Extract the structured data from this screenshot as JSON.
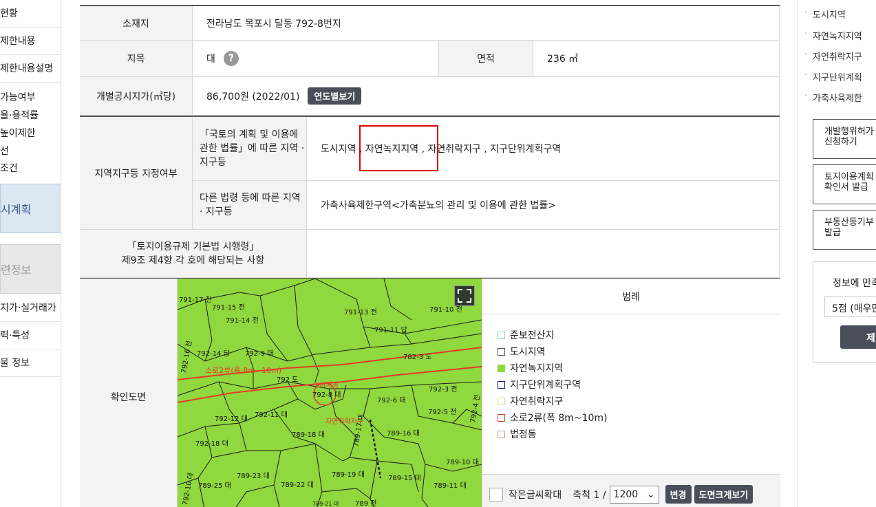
{
  "left_menu": {
    "items": [
      "현황",
      "제한내용",
      "제한내용설명",
      "가능여부",
      "율·용적률",
      "높이제한",
      "선",
      "조건"
    ],
    "active_box": "시계획",
    "section_box": "련정보",
    "related": [
      "지가·실거래가",
      "력·특성",
      "물 정보"
    ]
  },
  "table": {
    "location_label": "소재지",
    "location_value": "전라남도 목포시 달동 792-8번지",
    "jimok_label": "지목",
    "jimok_value": "대",
    "jimok_help": "?",
    "area_label": "면적",
    "area_value": "236 ㎡",
    "price_label": "개별공시지가(㎡당)",
    "price_value": "86,700원 (2022/01)",
    "price_button": "연도별보기",
    "zone_label": "지역지구등 지정여부",
    "zone_sub1_label": "「국토의 계획 및 이용에 관한 법률」에 따른 지역 · 지구등",
    "zone_sub1_value": "도시지역 , 자연녹지지역 , 자연취락지구 , 지구단위계획구역",
    "zone_sub2_label": "다른 법령 등에 따른 지역 · 지구등",
    "zone_sub2_value": "가축사육제한구역<가축분뇨의 관리 및 이용에 관한 법률>",
    "article_label_line1": "「토지이용규제 기본법 시행령」",
    "article_label_line2": "제9조 제4항 각 호에 해당되는 사항",
    "article_value": "",
    "map_label": "확인도면"
  },
  "map": {
    "labels": [
      "791-17 전",
      "791-15 전",
      "791-14 전",
      "791-13 전",
      "791-10 전",
      "791-11 답",
      "792-14 답",
      "792-9 대",
      "782-3 도",
      "792-16 전",
      "소로2류(폭 8m~10m)",
      "792 도",
      "도시지역",
      "792-8 대",
      "792-6 대",
      "792-3 전",
      "792-12 대",
      "792-11 대",
      "792-5 전",
      "792-4 전",
      "자연취락지구",
      "789-18 대",
      "789-17 대",
      "789-16 대",
      "792-18 대",
      "789-10 대",
      "789-23 대",
      "789-19 대",
      "789-22 대",
      "789-15 대",
      "789-25 대",
      "789-11 대",
      "792-10 대",
      "789-21 대",
      "789 전"
    ],
    "colors": {
      "fill": "#8fd83e",
      "road": "#e53a2a",
      "boundary": "#1a1a1a"
    }
  },
  "legend": {
    "title": "범례",
    "items": [
      {
        "label": "준보전산지",
        "color": "#7fd1c0",
        "fill": "#ffffff"
      },
      {
        "label": "도시지역",
        "color": "#555555",
        "fill": "#ffffff"
      },
      {
        "label": "자연녹지지역",
        "color": "#8fd83e",
        "fill": "#8fd83e"
      },
      {
        "label": "지구단위계획구역",
        "color": "#1a1a8c",
        "fill": "#ffffff"
      },
      {
        "label": "자연취락지구",
        "color": "#d7e08a",
        "fill": "#ffffff"
      },
      {
        "label": "소로2류(폭 8m~10m)",
        "color": "#d93a2a",
        "fill": "#ffffff"
      },
      {
        "label": "법정동",
        "color": "#b8a88a",
        "fill": "#ffffff"
      }
    ],
    "footer": {
      "checkbox_label": "작은글씨확대",
      "scale_label": "축척 1 /",
      "scale_value": "1200",
      "change_button": "변경",
      "enlarge_button": "도면크게보기"
    }
  },
  "right_menu": {
    "items": [
      "도시지역",
      "자연녹지지역",
      "자연취락지구",
      "지구단위계획",
      "가축사육제한"
    ],
    "buttons": [
      {
        "line1": "개발행위허가",
        "line2": "신청하기"
      },
      {
        "line1": "토지이용계획",
        "line2": "확인서 발급"
      },
      {
        "line1": "부동산등기부",
        "line2": "발급"
      }
    ],
    "survey": {
      "title": "정보에 만족",
      "selected": "5점 (매우만",
      "button": "제"
    }
  }
}
